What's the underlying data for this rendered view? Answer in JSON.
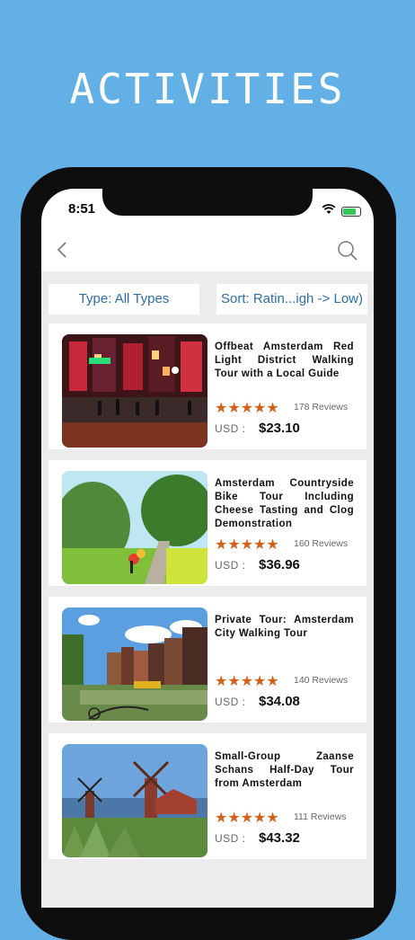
{
  "headline": "ACTIVITIES",
  "status_bar": {
    "time": "8:51"
  },
  "filters": {
    "type_label": "Type: All Types",
    "sort_label": "Sort: Ratin...igh -> Low)"
  },
  "listings": [
    {
      "title": "Offbeat Amsterdam Red Light District Walking Tour with a Local Guide",
      "stars": "★★★★★",
      "reviews": "178 Reviews",
      "currency": "USD :",
      "price": "$23.10"
    },
    {
      "title": "Amsterdam Countryside Bike Tour Including Cheese Tasting and Clog Demonstration",
      "stars": "★★★★★",
      "reviews": "160 Reviews",
      "currency": "USD :",
      "price": "$36.96"
    },
    {
      "title": "Private Tour: Amsterdam City Walking Tour",
      "stars": "★★★★★",
      "reviews": "140 Reviews",
      "currency": "USD :",
      "price": "$34.08"
    },
    {
      "title": "Small-Group Zaanse Schans Half-Day Tour from Amsterdam",
      "stars": "★★★★★",
      "reviews": "111 Reviews",
      "currency": "USD :",
      "price": "$43.32"
    }
  ],
  "icons": {
    "back": "chevron-left-icon",
    "search": "search-icon",
    "wifi": "wifi-icon",
    "battery": "battery-icon"
  },
  "colors": {
    "background": "#62b0e6",
    "filter_text": "#2c6fa8",
    "star": "#d2601a",
    "battery": "#34c759"
  }
}
